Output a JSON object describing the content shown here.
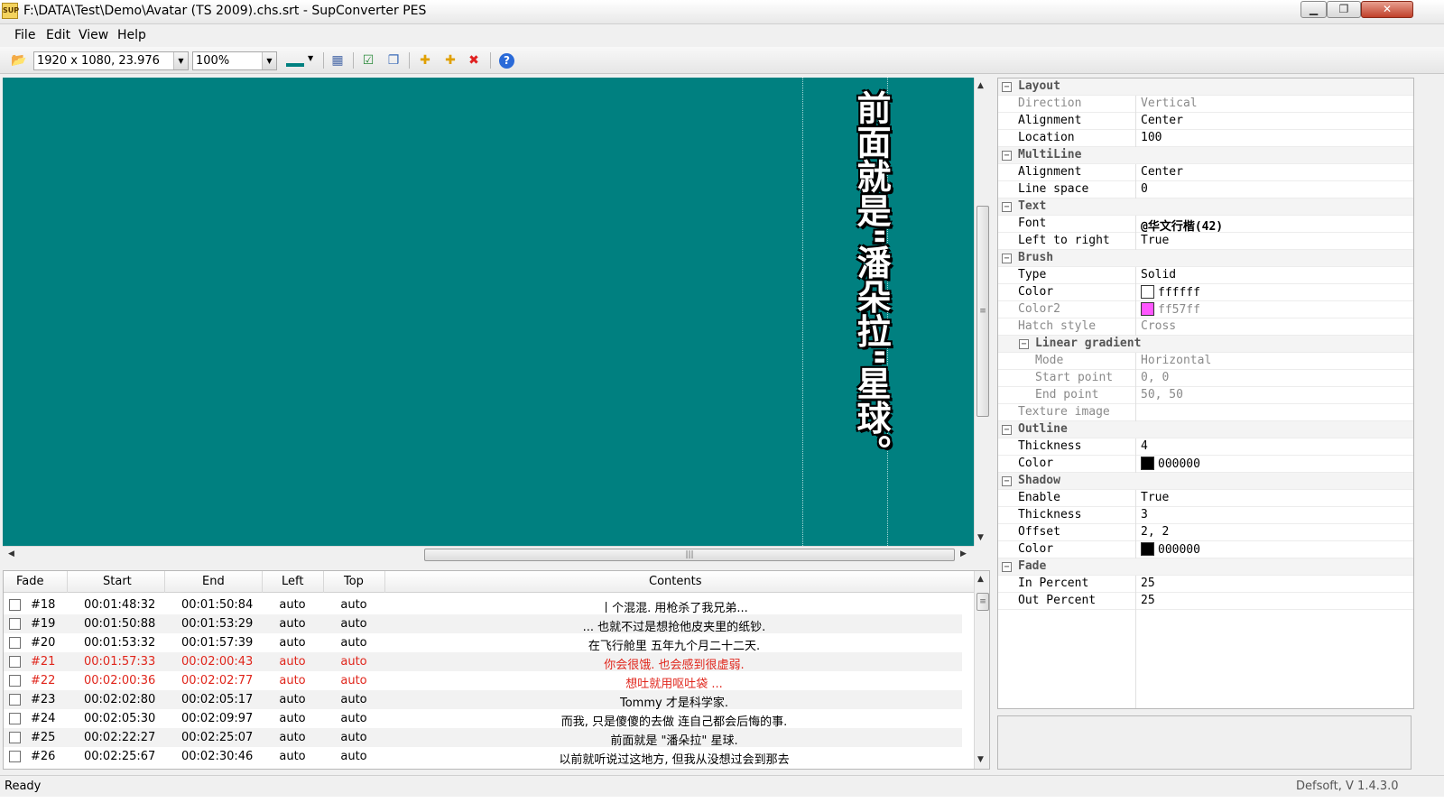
{
  "window": {
    "title": "F:\\DATA\\Test\\Demo\\Avatar (TS 2009).chs.srt - SupConverter PES",
    "icon_text": "SUP",
    "min_glyph": "▁",
    "max_glyph": "❐",
    "close_glyph": "✕"
  },
  "menu": {
    "file": "File",
    "edit": "Edit",
    "view": "View",
    "help": "Help"
  },
  "toolbar": {
    "resolution": "1920 x 1080, 23.976",
    "zoom": "100%",
    "dropdown_arrow": "▼",
    "icons": {
      "open": "📂",
      "calendar": "▦",
      "check": "☑",
      "windows": "❐",
      "add": "✚",
      "add_multi": "✚",
      "delete": "✖",
      "help": "?"
    }
  },
  "preview": {
    "subtitle_text": "前面就是\"潘朵拉\"星球。",
    "background": "#008080"
  },
  "table": {
    "headers": {
      "fade": "Fade",
      "start": "Start",
      "end": "End",
      "left": "Left",
      "top": "Top",
      "contents": "Contents"
    },
    "rows": [
      {
        "num": "#18",
        "start": "00:01:48:32",
        "end": "00:01:50:84",
        "left": "auto",
        "top": "auto",
        "contents": "丨个混混. 用枪杀了我兄弟..."
      },
      {
        "num": "#19",
        "start": "00:01:50:88",
        "end": "00:01:53:29",
        "left": "auto",
        "top": "auto",
        "contents": "... 也就不过是想抢他皮夹里的纸钞."
      },
      {
        "num": "#20",
        "start": "00:01:53:32",
        "end": "00:01:57:39",
        "left": "auto",
        "top": "auto",
        "contents": "在飞行舱里 五年九个月二十二天."
      },
      {
        "num": "#21",
        "start": "00:01:57:33",
        "end": "00:02:00:43",
        "left": "auto",
        "top": "auto",
        "contents": "你会很饿. 也会感到很虚弱."
      },
      {
        "num": "#22",
        "start": "00:02:00:36",
        "end": "00:02:02:77",
        "left": "auto",
        "top": "auto",
        "contents": "想吐就用呕吐袋 ..."
      },
      {
        "num": "#23",
        "start": "00:02:02:80",
        "end": "00:02:05:17",
        "left": "auto",
        "top": "auto",
        "contents": "Tommy 才是科学家."
      },
      {
        "num": "#24",
        "start": "00:02:05:30",
        "end": "00:02:09:97",
        "left": "auto",
        "top": "auto",
        "contents": "而我, 只是傻傻的去做 连自己都会后悔的事."
      },
      {
        "num": "#25",
        "start": "00:02:22:27",
        "end": "00:02:25:07",
        "left": "auto",
        "top": "auto",
        "contents": "前面就是 \"潘朵拉\" 星球."
      },
      {
        "num": "#26",
        "start": "00:02:25:67",
        "end": "00:02:30:46",
        "left": "auto",
        "top": "auto",
        "contents": "以前就听说过这地方, 但我从没想过会到那去"
      }
    ]
  },
  "props": {
    "layout": {
      "label": "Layout",
      "direction_label": "Direction",
      "direction": "Vertical",
      "alignment_label": "Alignment",
      "alignment": "Center",
      "location_label": "Location",
      "location": "100"
    },
    "multiline": {
      "label": "MultiLine",
      "alignment_label": "Alignment",
      "alignment": "Center",
      "line_space_label": "Line space",
      "line_space": "0"
    },
    "text": {
      "label": "Text",
      "font_label": "Font",
      "font": "@华文行楷(42)",
      "ltr_label": "Left to right",
      "ltr": "True"
    },
    "brush": {
      "label": "Brush",
      "type_label": "Type",
      "type": "Solid",
      "color_label": "Color",
      "color": "ffffff",
      "color_hex": "#ffffff",
      "color2_label": "Color2",
      "color2": "ff57ff",
      "color2_hex": "#ff57ff",
      "hatch_label": "Hatch style",
      "hatch": "Cross"
    },
    "gradient": {
      "label": "Linear gradient",
      "mode_label": "Mode",
      "mode": "Horizontal",
      "start_label": "Start point",
      "start": "0, 0",
      "end_label": "End point",
      "end": "50, 50",
      "texture_label": "Texture image"
    },
    "outline": {
      "label": "Outline",
      "thickness_label": "Thickness",
      "thickness": "4",
      "color_label": "Color",
      "color": "000000",
      "color_hex": "#000000"
    },
    "shadow": {
      "label": "Shadow",
      "enable_label": "Enable",
      "enable": "True",
      "thickness_label": "Thickness",
      "thickness": "3",
      "offset_label": "Offset",
      "offset": "2, 2",
      "color_label": "Color",
      "color": "000000",
      "color_hex": "#000000"
    },
    "fade": {
      "label": "Fade",
      "in_label": "In Percent",
      "in": "25",
      "out_label": "Out Percent",
      "out": "25"
    },
    "collapse_glyph": "−"
  },
  "status": {
    "text": "Ready",
    "version": "Defsoft, V 1.4.3.0"
  },
  "scroll_glyphs": {
    "up": "▲",
    "down": "▼",
    "left": "◀",
    "right": "▶",
    "grip_v": "≡",
    "grip_h": "|||"
  }
}
